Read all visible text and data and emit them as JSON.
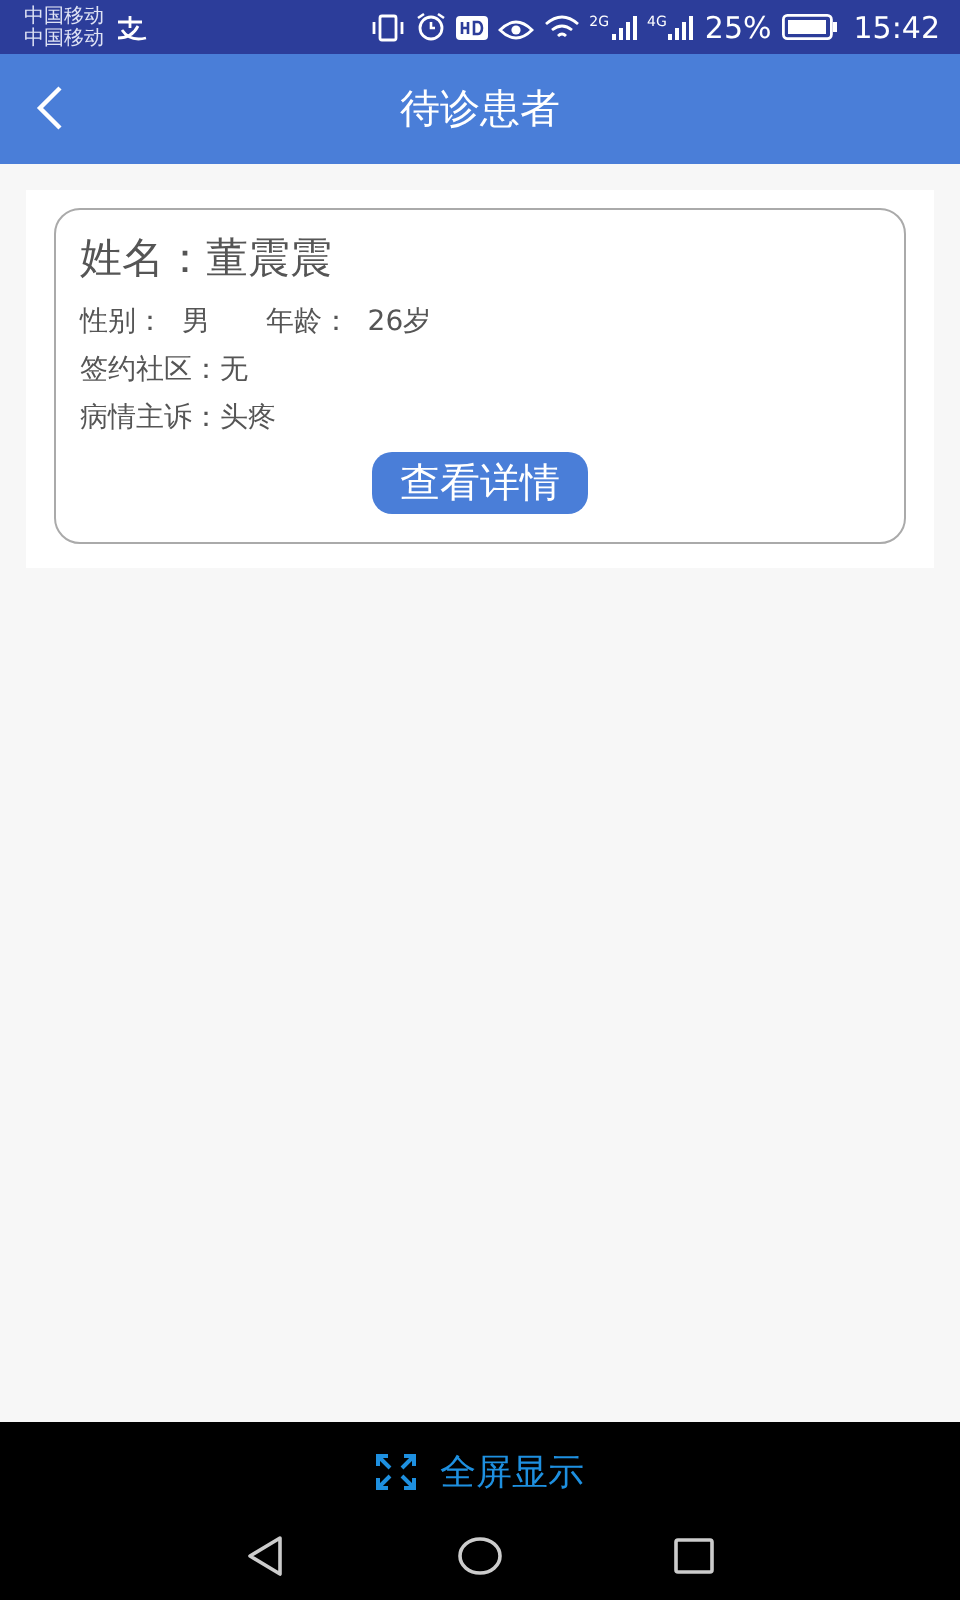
{
  "status_bar": {
    "carriers": [
      "中国移动",
      "中国移动"
    ],
    "networks": [
      "2G",
      "4G"
    ],
    "battery": "25%",
    "time": "15:42"
  },
  "header": {
    "title": "待诊患者"
  },
  "patients": [
    {
      "name_label": "姓名：",
      "name": "董震震",
      "gender_label": "性别：",
      "gender": "男",
      "age_label": "年龄：",
      "age": "26岁",
      "community_label": "签约社区：",
      "community": "无",
      "complaint_label": "病情主诉：",
      "complaint": "头疼",
      "button": "查看详情"
    }
  ],
  "bottom_bar": {
    "fullscreen": "全屏显示"
  }
}
